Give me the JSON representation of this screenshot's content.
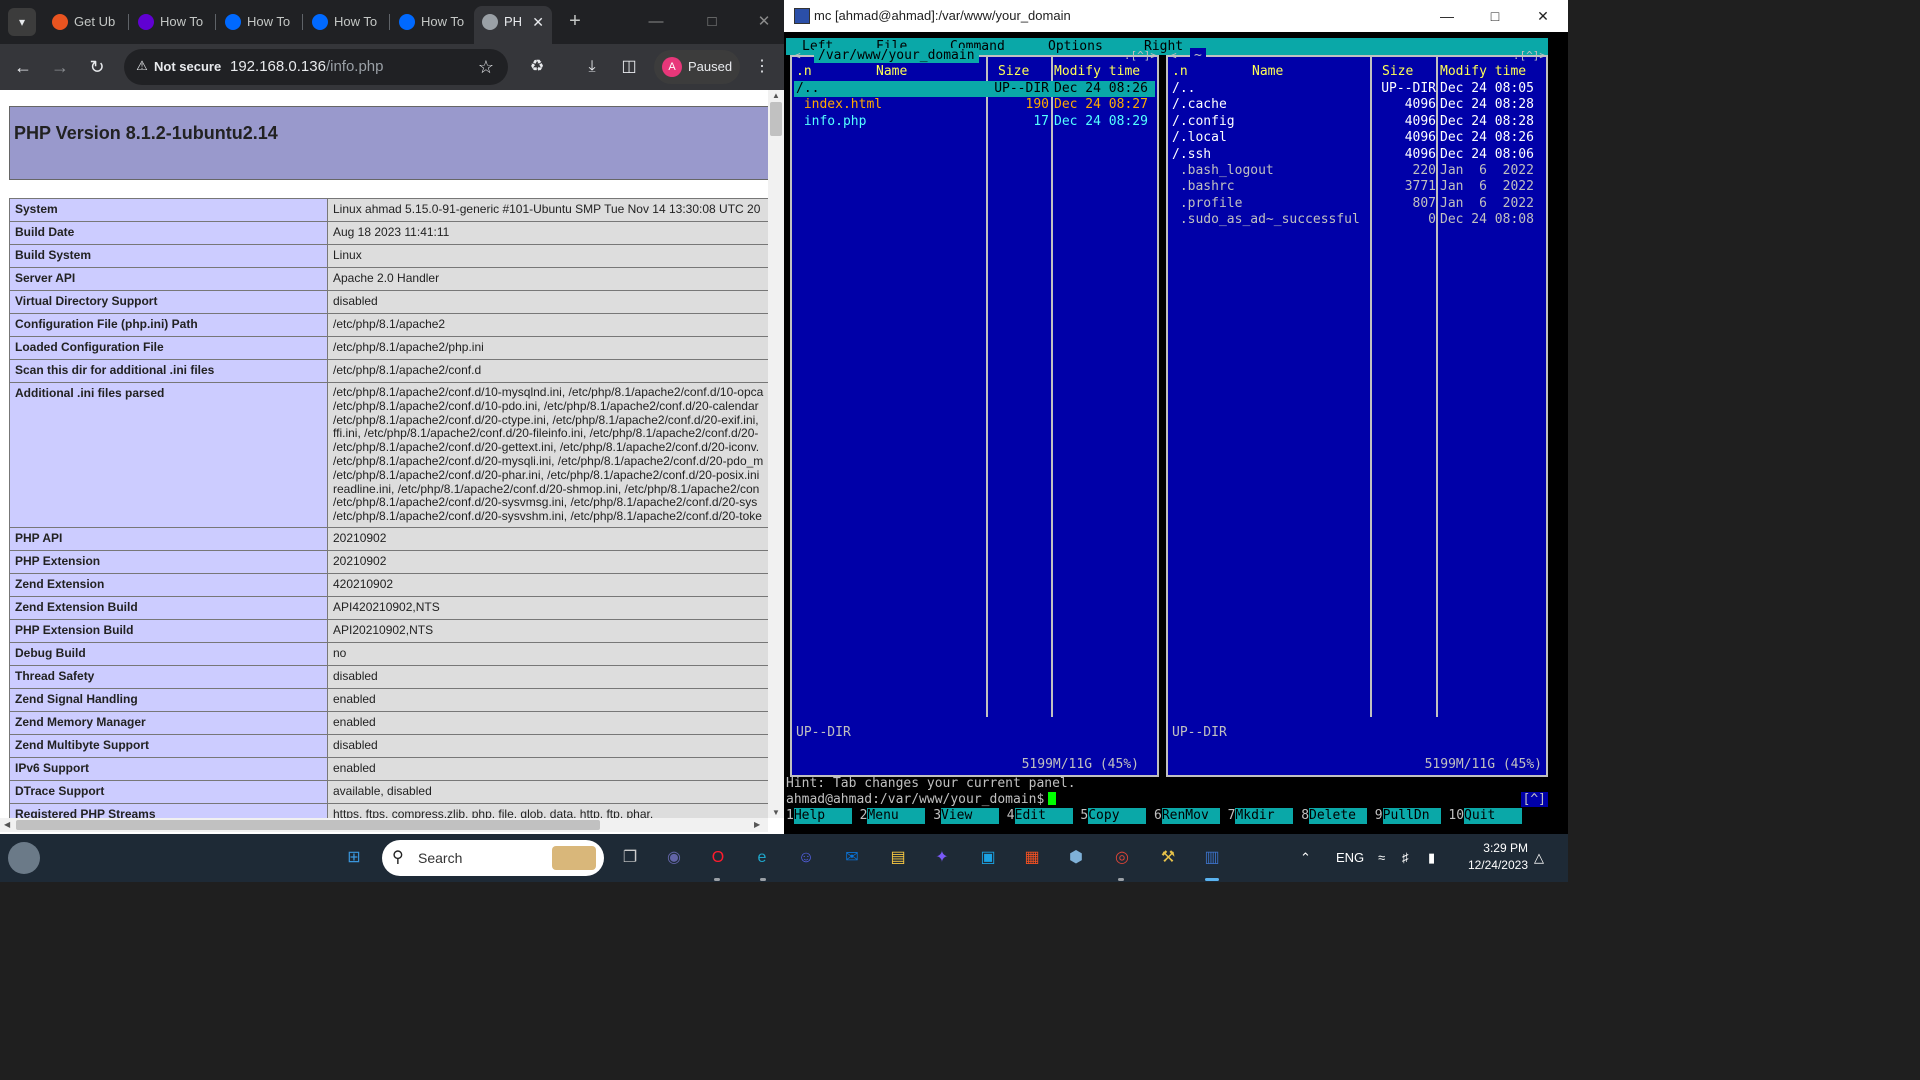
{
  "browser": {
    "tabs": [
      {
        "label": "Get Ub",
        "icon": "ubuntu-icon",
        "color": "#e95420"
      },
      {
        "label": "How To",
        "icon": "yahoo-icon",
        "color": "#6001d2"
      },
      {
        "label": "How To",
        "icon": "digitalocean-icon",
        "color": "#0069ff"
      },
      {
        "label": "How To",
        "icon": "digitalocean-icon",
        "color": "#0069ff"
      },
      {
        "label": "How To",
        "icon": "digitalocean-icon",
        "color": "#0069ff"
      },
      {
        "label": "PH",
        "icon": "globe-icon",
        "color": "#9aa0a6"
      }
    ],
    "not_secure_label": "Not secure",
    "url_host": "192.168.0.136",
    "url_path": "/info.php",
    "profile_initial": "A",
    "profile_label": "Paused"
  },
  "phpinfo": {
    "title": "PHP Version 8.1.2-1ubuntu2.14",
    "rows": [
      {
        "k": "System",
        "v": "Linux ahmad 5.15.0-91-generic #101-Ubuntu SMP Tue Nov 14 13:30:08 UTC 20"
      },
      {
        "k": "Build Date",
        "v": "Aug 18 2023 11:41:11"
      },
      {
        "k": "Build System",
        "v": "Linux"
      },
      {
        "k": "Server API",
        "v": "Apache 2.0 Handler"
      },
      {
        "k": "Virtual Directory Support",
        "v": "disabled"
      },
      {
        "k": "Configuration File (php.ini) Path",
        "v": "/etc/php/8.1/apache2"
      },
      {
        "k": "Loaded Configuration File",
        "v": "/etc/php/8.1/apache2/php.ini"
      },
      {
        "k": "Scan this dir for additional .ini files",
        "v": "/etc/php/8.1/apache2/conf.d"
      },
      {
        "k": "Additional .ini files parsed",
        "lines": [
          "/etc/php/8.1/apache2/conf.d/10-mysqlnd.ini, /etc/php/8.1/apache2/conf.d/10-opca",
          "/etc/php/8.1/apache2/conf.d/10-pdo.ini, /etc/php/8.1/apache2/conf.d/20-calendar",
          "/etc/php/8.1/apache2/conf.d/20-ctype.ini, /etc/php/8.1/apache2/conf.d/20-exif.ini,",
          "ffi.ini, /etc/php/8.1/apache2/conf.d/20-fileinfo.ini, /etc/php/8.1/apache2/conf.d/20-",
          "/etc/php/8.1/apache2/conf.d/20-gettext.ini, /etc/php/8.1/apache2/conf.d/20-iconv.",
          "/etc/php/8.1/apache2/conf.d/20-mysqli.ini, /etc/php/8.1/apache2/conf.d/20-pdo_m",
          "/etc/php/8.1/apache2/conf.d/20-phar.ini, /etc/php/8.1/apache2/conf.d/20-posix.ini",
          "readline.ini, /etc/php/8.1/apache2/conf.d/20-shmop.ini, /etc/php/8.1/apache2/con",
          "/etc/php/8.1/apache2/conf.d/20-sysvmsg.ini, /etc/php/8.1/apache2/conf.d/20-sys",
          "/etc/php/8.1/apache2/conf.d/20-sysvshm.ini, /etc/php/8.1/apache2/conf.d/20-toke"
        ]
      },
      {
        "k": "PHP API",
        "v": "20210902"
      },
      {
        "k": "PHP Extension",
        "v": "20210902"
      },
      {
        "k": "Zend Extension",
        "v": "420210902"
      },
      {
        "k": "Zend Extension Build",
        "v": "API420210902,NTS"
      },
      {
        "k": "PHP Extension Build",
        "v": "API20210902,NTS"
      },
      {
        "k": "Debug Build",
        "v": "no"
      },
      {
        "k": "Thread Safety",
        "v": "disabled"
      },
      {
        "k": "Zend Signal Handling",
        "v": "enabled"
      },
      {
        "k": "Zend Memory Manager",
        "v": "enabled"
      },
      {
        "k": "Zend Multibyte Support",
        "v": "disabled"
      },
      {
        "k": "IPv6 Support",
        "v": "enabled"
      },
      {
        "k": "DTrace Support",
        "v": "available, disabled"
      },
      {
        "k": "Registered PHP Streams",
        "v": "https, ftps, compress.zlib, php, file, glob, data, http, ftp, phar,"
      }
    ]
  },
  "terminal": {
    "title": "mc [ahmad@ahmad]:/var/www/your_domain",
    "menu": [
      "Left",
      "File",
      "Command",
      "Options",
      "Right"
    ],
    "left_panel": {
      "path": "/var/www/your_domain",
      "corner": ".[^]>",
      "corner_left": "<-",
      "col_n": ".n",
      "col_name": "Name",
      "col_size": "Size",
      "col_time": "Modify time",
      "rows": [
        {
          "name": "/..",
          "size": "UP--DIR",
          "time": "Dec 24 08:26",
          "cls": "sel"
        },
        {
          "name": " index.html",
          "size": "190",
          "time": "Dec 24 08:27",
          "cls": "c-orange"
        },
        {
          "name": " info.php",
          "size": "17",
          "time": "Dec 24 08:29",
          "cls": "c-cyan"
        }
      ],
      "mini": "UP--DIR",
      "free": "5199M/11G (45%)"
    },
    "right_panel": {
      "path": "~",
      "corner": ".[^]>",
      "corner_left": "<-",
      "col_n": ".n",
      "col_name": "Name",
      "col_size": "Size",
      "col_time": "Modify time",
      "rows": [
        {
          "name": "/..",
          "size": "UP--DIR",
          "time": "Dec 24 08:05",
          "cls": "c-white"
        },
        {
          "name": "/.cache",
          "size": "4096",
          "time": "Dec 24 08:28",
          "cls": "c-white"
        },
        {
          "name": "/.config",
          "size": "4096",
          "time": "Dec 24 08:28",
          "cls": "c-white"
        },
        {
          "name": "/.local",
          "size": "4096",
          "time": "Dec 24 08:26",
          "cls": "c-white"
        },
        {
          "name": "/.ssh",
          "size": "4096",
          "time": "Dec 24 08:06",
          "cls": "c-white"
        },
        {
          "name": " .bash_logout",
          "size": "220",
          "time": "Jan  6  2022",
          "cls": "c-gray"
        },
        {
          "name": " .bashrc",
          "size": "3771",
          "time": "Jan  6  2022",
          "cls": "c-gray"
        },
        {
          "name": " .profile",
          "size": "807",
          "time": "Jan  6  2022",
          "cls": "c-gray"
        },
        {
          "name": " .sudo_as_ad~_successful",
          "size": "0",
          "time": "Dec 24 08:08",
          "cls": "c-gray"
        }
      ],
      "mini": "UP--DIR",
      "free": "5199M/11G (45%)"
    },
    "hint": "Hint: Tab changes your current panel.",
    "prompt": "ahmad@ahmad:/var/www/your_domain$",
    "prompt_corner": "[^]",
    "fkeys": [
      {
        "num": "1",
        "label": "Help"
      },
      {
        "num": "2",
        "label": "Menu"
      },
      {
        "num": "3",
        "label": "View"
      },
      {
        "num": "4",
        "label": "Edit"
      },
      {
        "num": "5",
        "label": "Copy"
      },
      {
        "num": "6",
        "label": "RenMov"
      },
      {
        "num": "7",
        "label": "Mkdir"
      },
      {
        "num": "8",
        "label": "Delete"
      },
      {
        "num": "9",
        "label": "PullDn"
      },
      {
        "num": "10",
        "label": "Quit"
      }
    ]
  },
  "taskbar": {
    "search_label": "Search",
    "language": "ENG",
    "time": "3:29 PM",
    "date": "12/24/2023",
    "apps": [
      {
        "icon": "windows-start-icon",
        "color": "#3a96dd"
      },
      {
        "icon": "task-view-icon",
        "color": "#cccccc"
      },
      {
        "icon": "teams-icon",
        "color": "#6264a7"
      },
      {
        "icon": "opera-icon",
        "color": "#ff1b2d"
      },
      {
        "icon": "edge-icon",
        "color": "#1fa5c9"
      },
      {
        "icon": "discord-icon",
        "color": "#5865f2"
      },
      {
        "icon": "mail-icon",
        "color": "#0a74da"
      },
      {
        "icon": "file-explorer-icon",
        "color": "#f8c842"
      },
      {
        "icon": "copilot-icon",
        "color": "#7a5af8"
      },
      {
        "icon": "remote-desktop-icon",
        "color": "#1ba1e2"
      },
      {
        "icon": "microsoft-store-icon",
        "color": "#f25022"
      },
      {
        "icon": "virtualbox-icon",
        "color": "#7fb1d8"
      },
      {
        "icon": "chrome-icon",
        "color": "#db4437"
      },
      {
        "icon": "winscp-icon",
        "color": "#e7c24a"
      },
      {
        "icon": "putty-icon",
        "color": "#3b6fc4"
      }
    ]
  }
}
